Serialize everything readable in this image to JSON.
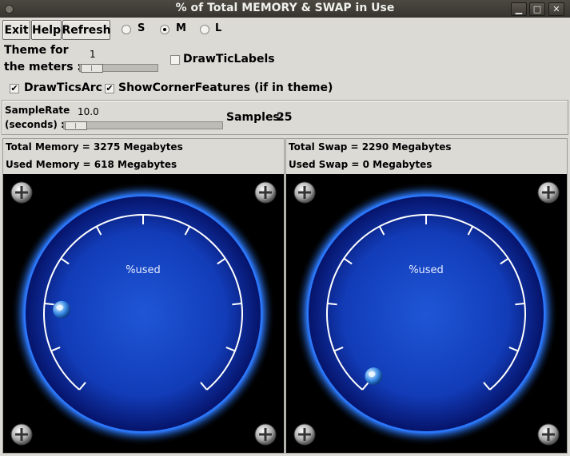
{
  "window": {
    "title": "% of Total MEMORY & SWAP in Use"
  },
  "toolbar": {
    "exit_label": "Exit",
    "help_label": "Help",
    "refresh_label": "Refresh",
    "size_options": [
      "S",
      "M",
      "L"
    ],
    "size_selected": "M"
  },
  "theme": {
    "label_line1": "Theme for",
    "label_line2": "the meters :",
    "value": "1",
    "slider_fraction": 0.05
  },
  "options": {
    "draw_tic_labels": {
      "label": "DrawTicLabels",
      "checked": false
    },
    "draw_tics_arc": {
      "label": "DrawTicsArc",
      "checked": true
    },
    "show_corner_features": {
      "label": "ShowCornerFeatures (if in theme)",
      "checked": true
    }
  },
  "sample": {
    "rate_label_line1": "SampleRate",
    "rate_label_line2": "(seconds) :",
    "rate_value": "10.0",
    "rate_slider_fraction": 0.05,
    "samples_label": "Samples:",
    "samples_value": "25"
  },
  "memory": {
    "total_text": "Total Memory = 3275 Megabytes",
    "used_text": "Used Memory = 618 Megabytes",
    "gauge_label": "%used",
    "percent_used": 18.9
  },
  "swap": {
    "total_text": "Total Swap = 2290 Megabytes",
    "used_text": "Used Swap = 0 Megabytes",
    "gauge_label": "%used",
    "percent_used": 0
  },
  "colors": {
    "gauge_bg": "#000000",
    "gauge_blue": "#1f56d6",
    "gauge_glow": "#0a35c9"
  }
}
